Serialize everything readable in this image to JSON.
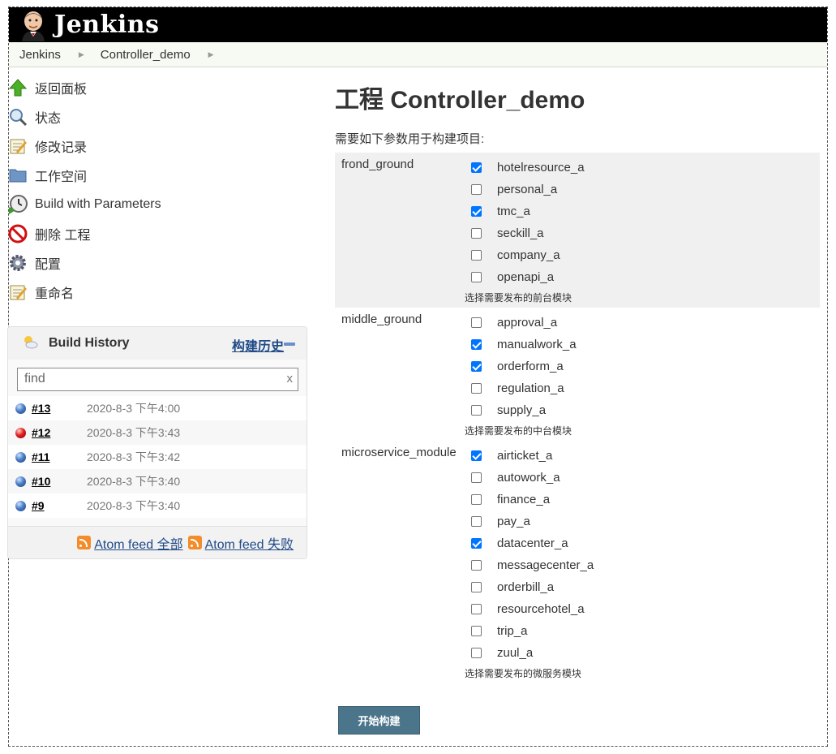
{
  "header": {
    "title": "Jenkins"
  },
  "breadcrumb": [
    {
      "label": "Jenkins"
    },
    {
      "label": "Controller_demo"
    }
  ],
  "tasks": [
    {
      "label": "返回面板",
      "icon": "up-arrow-icon"
    },
    {
      "label": "状态",
      "icon": "magnifier-icon"
    },
    {
      "label": "修改记录",
      "icon": "notepad-icon"
    },
    {
      "label": "工作空间",
      "icon": "folder-icon"
    },
    {
      "label": "Build with Parameters",
      "icon": "clock-icon"
    },
    {
      "label": "删除 工程",
      "icon": "no-entry-icon"
    },
    {
      "label": "配置",
      "icon": "gear-icon"
    },
    {
      "label": "重命名",
      "icon": "notepad-icon"
    }
  ],
  "build_history": {
    "title": "Build History",
    "trend_label": "构建历史",
    "search_placeholder": "find",
    "clear_label": "x",
    "builds": [
      {
        "number": "#13",
        "date": "2020-8-3 下午4:00",
        "status": "blue"
      },
      {
        "number": "#12",
        "date": "2020-8-3 下午3:43",
        "status": "red"
      },
      {
        "number": "#11",
        "date": "2020-8-3 下午3:42",
        "status": "blue"
      },
      {
        "number": "#10",
        "date": "2020-8-3 下午3:40",
        "status": "blue"
      },
      {
        "number": "#9",
        "date": "2020-8-3 下午3:40",
        "status": "blue"
      }
    ],
    "feed_all": "Atom feed 全部",
    "feed_failed": "Atom feed 失败"
  },
  "main": {
    "title": "工程 Controller_demo",
    "subtitle": "需要如下参数用于构建项目:",
    "parameters": [
      {
        "name": "frond_ground",
        "description": "选择需要发布的前台模块",
        "options": [
          {
            "label": "hotelresource_a",
            "checked": true
          },
          {
            "label": "personal_a",
            "checked": false
          },
          {
            "label": "tmc_a",
            "checked": true
          },
          {
            "label": "seckill_a",
            "checked": false
          },
          {
            "label": "company_a",
            "checked": false
          },
          {
            "label": "openapi_a",
            "checked": false
          }
        ]
      },
      {
        "name": "middle_ground",
        "description": "选择需要发布的中台模块",
        "options": [
          {
            "label": "approval_a",
            "checked": false
          },
          {
            "label": "manualwork_a",
            "checked": true
          },
          {
            "label": "orderform_a",
            "checked": true
          },
          {
            "label": "regulation_a",
            "checked": false
          },
          {
            "label": "supply_a",
            "checked": false
          }
        ]
      },
      {
        "name": "microservice_module",
        "description": "选择需要发布的微服务模块",
        "options": [
          {
            "label": "airticket_a",
            "checked": true
          },
          {
            "label": "autowork_a",
            "checked": false
          },
          {
            "label": "finance_a",
            "checked": false
          },
          {
            "label": "pay_a",
            "checked": false
          },
          {
            "label": "datacenter_a",
            "checked": true
          },
          {
            "label": "messagecenter_a",
            "checked": false
          },
          {
            "label": "orderbill_a",
            "checked": false
          },
          {
            "label": "resourcehotel_a",
            "checked": false
          },
          {
            "label": "trip_a",
            "checked": false
          },
          {
            "label": "zuul_a",
            "checked": false
          }
        ]
      }
    ],
    "build_button": "开始构建"
  },
  "colors": {
    "header_bg": "#000000",
    "button_bg": "#4b758b",
    "link": "#204a87",
    "checkbox_on": "#0075ff"
  }
}
